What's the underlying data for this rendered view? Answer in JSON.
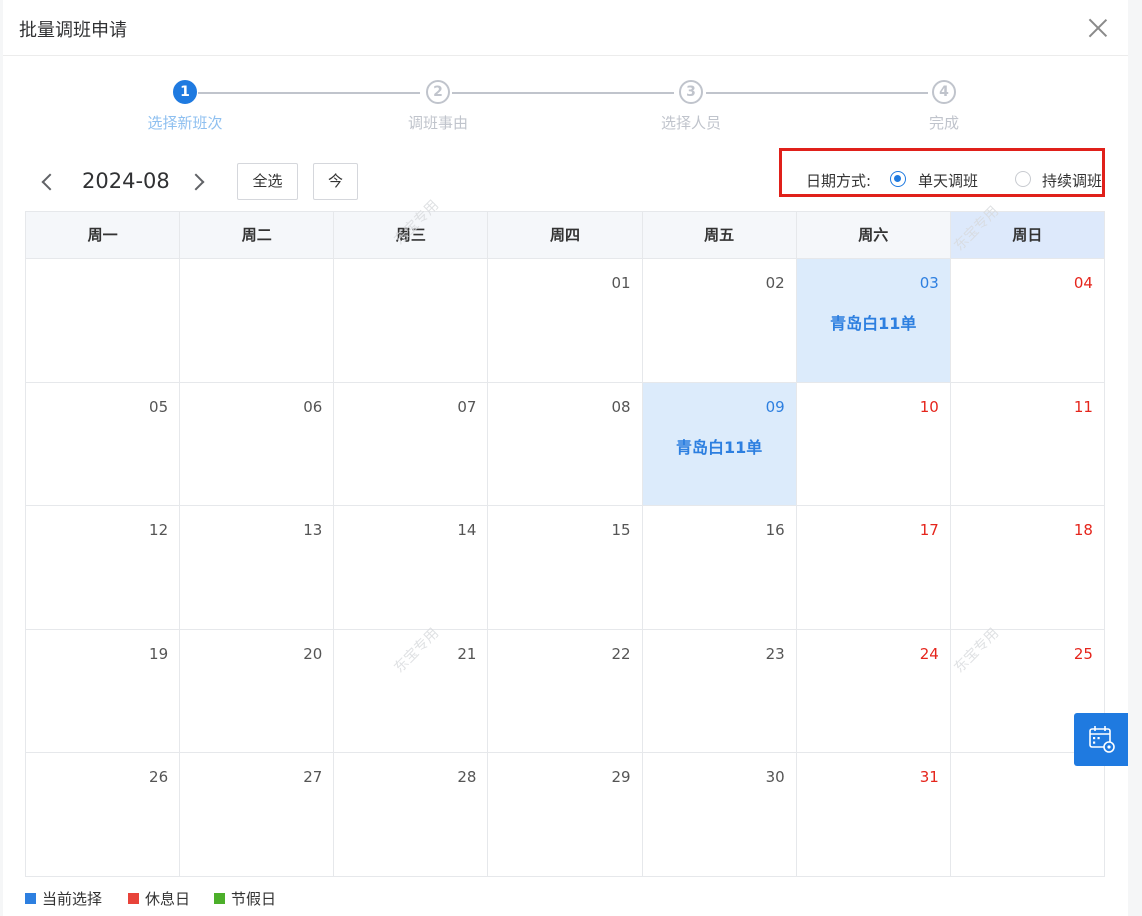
{
  "dialog": {
    "title": "批量调班申请"
  },
  "steps": [
    {
      "num": "1",
      "label": "选择新班次",
      "active": true
    },
    {
      "num": "2",
      "label": "调班事由",
      "active": false
    },
    {
      "num": "3",
      "label": "选择人员",
      "active": false
    },
    {
      "num": "4",
      "label": "完成",
      "active": false
    }
  ],
  "toolbar": {
    "month": "2024-08",
    "select_all_label": "全选",
    "today_label": "今"
  },
  "date_mode": {
    "label": "日期方式:",
    "options": [
      {
        "label": "单天调班",
        "checked": true
      },
      {
        "label": "持续调班",
        "checked": false
      }
    ]
  },
  "calendar": {
    "weekdays": [
      "周一",
      "周二",
      "周三",
      "周四",
      "周五",
      "周六",
      "周日"
    ],
    "weeks": [
      [
        {
          "day": "",
          "rest": false,
          "selected": false,
          "shift": ""
        },
        {
          "day": "",
          "rest": false,
          "selected": false,
          "shift": ""
        },
        {
          "day": "",
          "rest": false,
          "selected": false,
          "shift": ""
        },
        {
          "day": "01",
          "rest": false,
          "selected": false,
          "shift": ""
        },
        {
          "day": "02",
          "rest": false,
          "selected": false,
          "shift": ""
        },
        {
          "day": "03",
          "rest": true,
          "selected": true,
          "shift": "青岛白11单"
        },
        {
          "day": "04",
          "rest": true,
          "selected": false,
          "shift": ""
        }
      ],
      [
        {
          "day": "05",
          "rest": false,
          "selected": false,
          "shift": ""
        },
        {
          "day": "06",
          "rest": false,
          "selected": false,
          "shift": ""
        },
        {
          "day": "07",
          "rest": false,
          "selected": false,
          "shift": ""
        },
        {
          "day": "08",
          "rest": false,
          "selected": false,
          "shift": ""
        },
        {
          "day": "09",
          "rest": false,
          "selected": true,
          "shift": "青岛白11单"
        },
        {
          "day": "10",
          "rest": true,
          "selected": false,
          "shift": ""
        },
        {
          "day": "11",
          "rest": true,
          "selected": false,
          "shift": ""
        }
      ],
      [
        {
          "day": "12",
          "rest": false,
          "selected": false,
          "shift": ""
        },
        {
          "day": "13",
          "rest": false,
          "selected": false,
          "shift": ""
        },
        {
          "day": "14",
          "rest": false,
          "selected": false,
          "shift": ""
        },
        {
          "day": "15",
          "rest": false,
          "selected": false,
          "shift": ""
        },
        {
          "day": "16",
          "rest": false,
          "selected": false,
          "shift": ""
        },
        {
          "day": "17",
          "rest": true,
          "selected": false,
          "shift": ""
        },
        {
          "day": "18",
          "rest": true,
          "selected": false,
          "shift": ""
        }
      ],
      [
        {
          "day": "19",
          "rest": false,
          "selected": false,
          "shift": ""
        },
        {
          "day": "20",
          "rest": false,
          "selected": false,
          "shift": ""
        },
        {
          "day": "21",
          "rest": false,
          "selected": false,
          "shift": ""
        },
        {
          "day": "22",
          "rest": false,
          "selected": false,
          "shift": ""
        },
        {
          "day": "23",
          "rest": false,
          "selected": false,
          "shift": ""
        },
        {
          "day": "24",
          "rest": true,
          "selected": false,
          "shift": ""
        },
        {
          "day": "25",
          "rest": true,
          "selected": false,
          "shift": ""
        }
      ],
      [
        {
          "day": "26",
          "rest": false,
          "selected": false,
          "shift": ""
        },
        {
          "day": "27",
          "rest": false,
          "selected": false,
          "shift": ""
        },
        {
          "day": "28",
          "rest": false,
          "selected": false,
          "shift": ""
        },
        {
          "day": "29",
          "rest": false,
          "selected": false,
          "shift": ""
        },
        {
          "day": "30",
          "rest": false,
          "selected": false,
          "shift": ""
        },
        {
          "day": "31",
          "rest": true,
          "selected": false,
          "shift": ""
        },
        {
          "day": "",
          "rest": false,
          "selected": false,
          "shift": ""
        }
      ]
    ]
  },
  "legend": [
    {
      "label": "当前选择",
      "color": "#2d7fe0"
    },
    {
      "label": "休息日",
      "color": "#e8433a"
    },
    {
      "label": "节假日",
      "color": "#4caf2a"
    }
  ],
  "watermark_text": "东宝专用",
  "colors": {
    "accent": "#1f7ae0",
    "rest_day": "#e5251c",
    "selected_bg": "#dcebfb",
    "highlight_box": "#e0201a"
  },
  "icons": {
    "float_button": "calendar-settings-icon"
  }
}
